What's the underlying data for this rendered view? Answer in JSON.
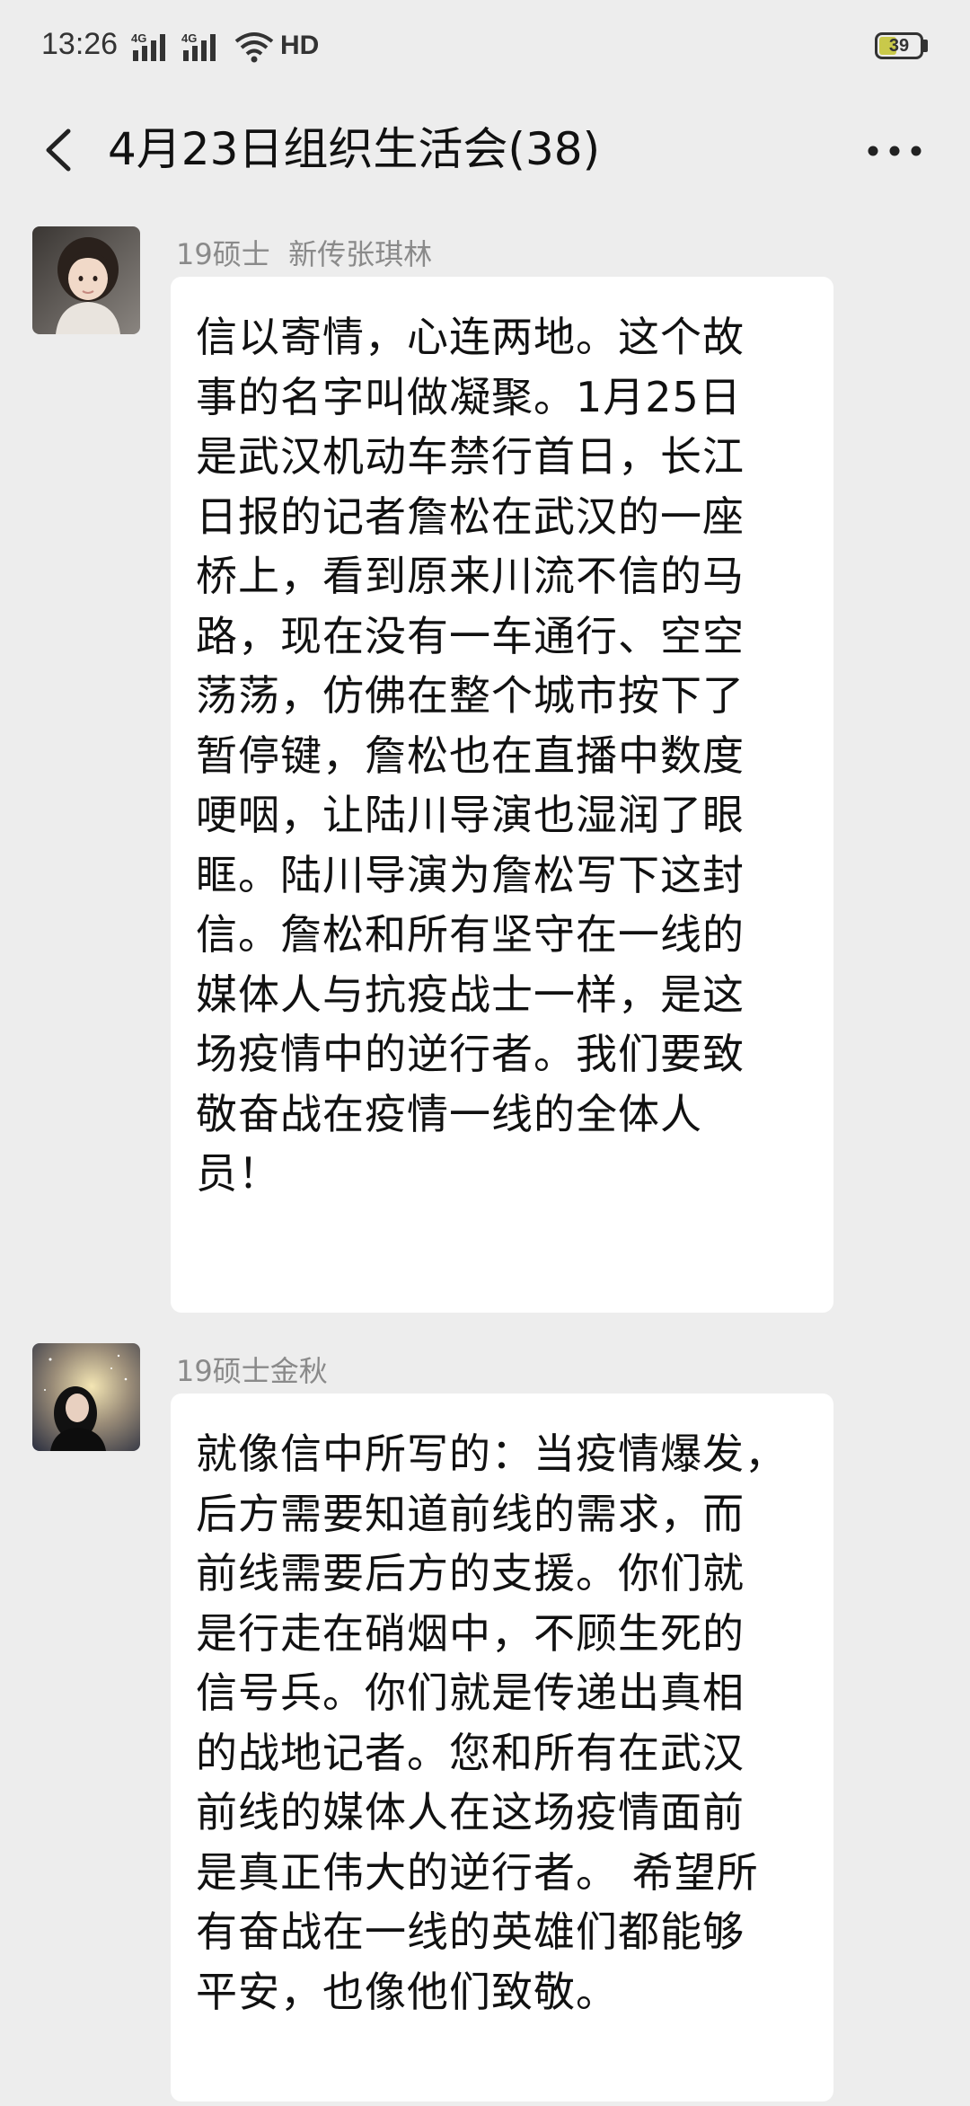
{
  "status_bar": {
    "time": "13:26",
    "network_1": "4G",
    "network_2": "4G",
    "hd": "HD",
    "battery": "39"
  },
  "header": {
    "title": "4月23日组织生活会(38)",
    "back_icon": "chevron-left-icon",
    "more_icon": "more-dots-icon"
  },
  "messages": [
    {
      "sender": "19硕士  新传张琪林",
      "text": "信以寄情，心连两地。这个故事的名字叫做凝聚。1月25日是武汉机动车禁行首日，长江日报的记者詹松在武汉的一座桥上，看到原来川流不信的马路，现在没有一车通行、空空荡荡，仿佛在整个城市按下了暂停键，詹松也在直播中数度哽咽，让陆川导演也湿润了眼眶。陆川导演为詹松写下这封信。詹松和所有坚守在一线的媒体人与抗疫战士一样，是这场疫情中的逆行者。我们要致敬奋战在疫情一线的全体人员！",
      "lines": [
        "信以寄情，心连两地。这个故",
        "事的名字叫做凝聚。1月25日",
        "是武汉机动车禁行首日，长江",
        "日报的记者詹松在武汉的一座",
        "桥上，看到原来川流不信的马",
        "路，现在没有一车通行、空空",
        "荡荡，仿佛在整个城市按下了",
        "暂停键，詹松也在直播中数度",
        "哽咽，让陆川导演也湿润了眼",
        "眶。陆川导演为詹松写下这封",
        "信。詹松和所有坚守在一线的",
        "媒体人与抗疫战士一样，是这",
        "场疫情中的逆行者。我们要致",
        "敬奋战在疫情一线的全体人",
        "员！"
      ]
    },
    {
      "sender": "19硕士金秋",
      "lines": [
        "就像信中所写的：当疫情爆发，",
        "后方需要知道前线的需求，而",
        "前线需要后方的支援。你们就",
        "是行走在硝烟中，不顾生死的",
        "信号兵。你们就是传递出真相",
        "的战地记者。您和所有在武汉",
        "前线的媒体人在这场疫情面前",
        "是真正伟大的逆行者。 希望所",
        "有奋战在一线的英雄们都能够",
        "平安，也像他们致敬。"
      ]
    }
  ]
}
